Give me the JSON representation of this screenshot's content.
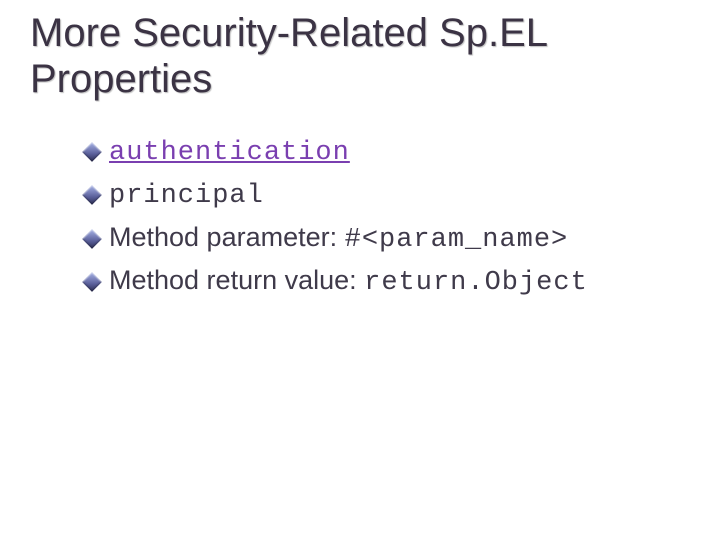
{
  "title": "More Security-Related Sp.EL Properties",
  "bullets": [
    {
      "prefix": "",
      "code": "authentication",
      "suffix": "",
      "is_link": true
    },
    {
      "prefix": "",
      "code": "principal",
      "suffix": "",
      "is_link": false
    },
    {
      "prefix": "Method parameter: ",
      "code": "#<param_name>",
      "suffix": "",
      "is_link": false
    },
    {
      "prefix": "Method return value: ",
      "code": "return.Object",
      "suffix": "",
      "is_link": false
    }
  ]
}
